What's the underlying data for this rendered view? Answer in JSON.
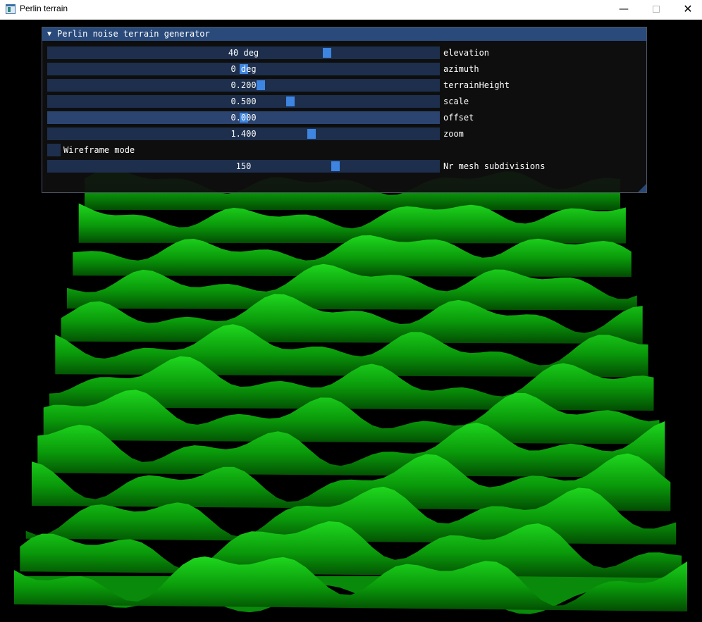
{
  "window": {
    "title": "Perlin terrain",
    "minimize": "—",
    "close": "✕"
  },
  "panel": {
    "title": "Perlin noise terrain generator",
    "collapse_icon": "▼",
    "sliders": [
      {
        "label": "elevation",
        "value": "40 deg",
        "fraction": 0.717
      },
      {
        "label": "azimuth",
        "value": "0 deg",
        "fraction": 0.5
      },
      {
        "label": "terrainHeight",
        "value": "0.200",
        "fraction": 0.545
      },
      {
        "label": "scale",
        "value": "0.500",
        "fraction": 0.622
      },
      {
        "label": "offset",
        "value": "0.000",
        "fraction": 0.5
      },
      {
        "label": "zoom",
        "value": "1.400",
        "fraction": 0.677
      }
    ],
    "wireframe": {
      "label": "Wireframe mode",
      "checked": false
    },
    "subdivisions": {
      "label": "Nr mesh subdivisions",
      "value": "150",
      "fraction": 0.74
    }
  },
  "colors": {
    "terrain_light": "#22e022",
    "terrain_dark": "#004000",
    "header": "#294a7a",
    "grab": "#3d85e0"
  }
}
